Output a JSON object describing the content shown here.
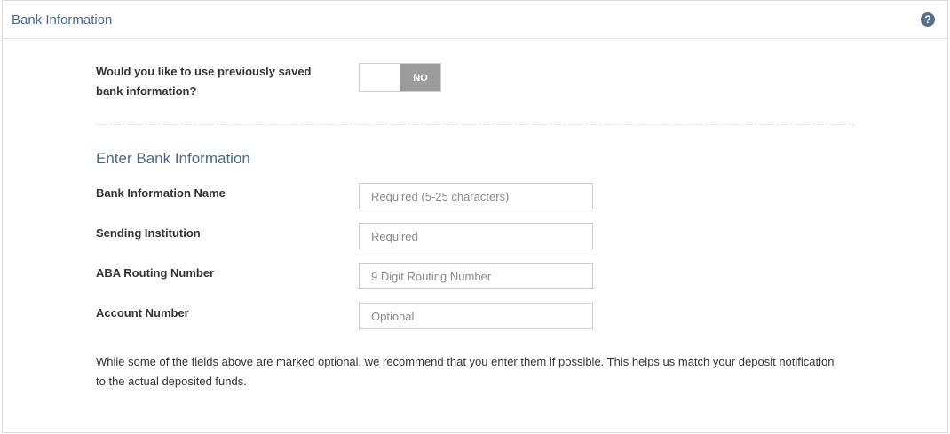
{
  "header": {
    "title": "Bank Information",
    "help_icon": "question-circle-icon"
  },
  "saved_info": {
    "question": "Would you like to use previously saved bank information?",
    "toggle_state": "NO"
  },
  "form": {
    "section_title": "Enter Bank Information",
    "fields": [
      {
        "label": "Bank Information Name",
        "placeholder": "Required (5-25 characters)",
        "value": ""
      },
      {
        "label": "Sending Institution",
        "placeholder": "Required",
        "value": ""
      },
      {
        "label": "ABA Routing Number",
        "placeholder": "9 Digit Routing Number",
        "value": ""
      },
      {
        "label": "Account Number",
        "placeholder": "Optional",
        "value": ""
      }
    ],
    "note": "While some of the fields above are marked optional, we recommend that you enter them if possible. This helps us match your deposit notification to the actual deposited funds."
  },
  "colors": {
    "heading": "#4a6a8a",
    "help_icon": "#56708c",
    "toggle_off": "#9b9b9b"
  }
}
